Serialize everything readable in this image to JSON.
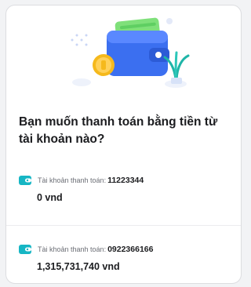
{
  "prompt": {
    "question": "Bạn muốn thanh toán bằng tiền từ tài khoản nào?"
  },
  "accounts": [
    {
      "label": "Tài khoản thanh toán:",
      "number": "11223344",
      "balance": "0 vnd"
    },
    {
      "label": "Tài khoản thanh toán:",
      "number": "0922366166",
      "balance": "1,315,731,740 vnd"
    }
  ],
  "colors": {
    "accent": "#16b6c4",
    "wallet_blue": "#3b6ff0",
    "coin_gold": "#f5b91c",
    "card_green": "#7fe07a",
    "text_primary": "#1b1c1f",
    "text_secondary": "#6b6e75"
  },
  "icons": {
    "hero": "wallet-illustration",
    "account": "wallet-icon"
  }
}
